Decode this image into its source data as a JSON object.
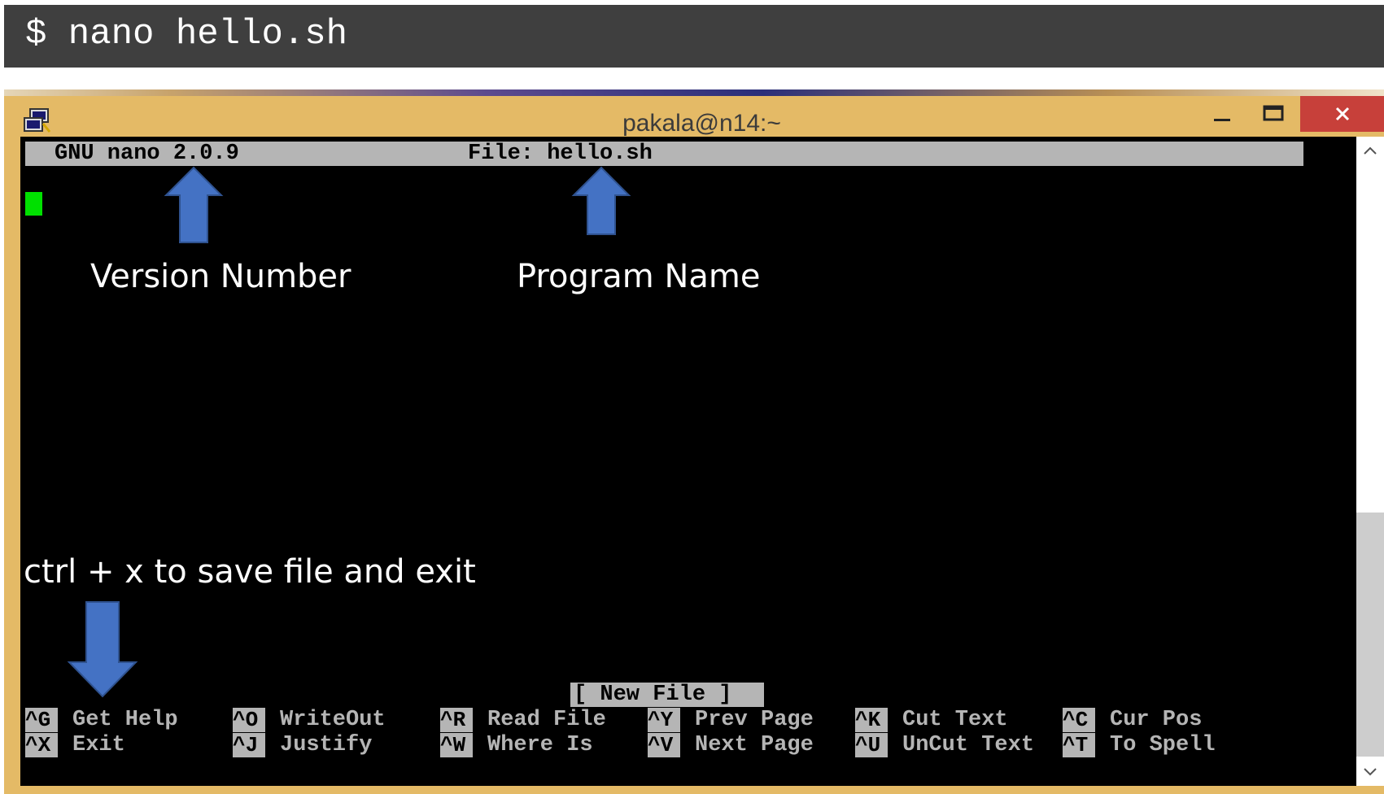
{
  "command": {
    "text": "$ nano hello.sh"
  },
  "window": {
    "title": "pakala@n14:~",
    "icons": {
      "app": "putty-icon",
      "minimize": "minimize-icon",
      "maximize": "maximize-icon",
      "close": "close-icon"
    },
    "colors": {
      "frame": "#e4ba66",
      "close_button": "#c7403a"
    }
  },
  "nano": {
    "version_label": "GNU nano 2.0.9",
    "file_label": "File: hello.sh",
    "status_message": "[ New File ]",
    "shortcuts": [
      [
        {
          "key": "^G",
          "label": "Get Help"
        },
        {
          "key": "^O",
          "label": "WriteOut"
        },
        {
          "key": "^R",
          "label": "Read File"
        },
        {
          "key": "^Y",
          "label": "Prev Page"
        },
        {
          "key": "^K",
          "label": "Cut Text"
        },
        {
          "key": "^C",
          "label": "Cur Pos"
        }
      ],
      [
        {
          "key": "^X",
          "label": "Exit"
        },
        {
          "key": "^J",
          "label": "Justify"
        },
        {
          "key": "^W",
          "label": "Where Is"
        },
        {
          "key": "^V",
          "label": "Next Page"
        },
        {
          "key": "^U",
          "label": "UnCut Text"
        },
        {
          "key": "^T",
          "label": "To Spell"
        }
      ]
    ],
    "colors": {
      "bar": "#b5b5b5",
      "cursor": "#00e000",
      "background": "#000000"
    }
  },
  "annotations": {
    "version_number": "Version Number",
    "program_name": "Program Name",
    "exit_hint": "ctrl + x to save file and exit",
    "arrow_color": "#4472c4"
  }
}
